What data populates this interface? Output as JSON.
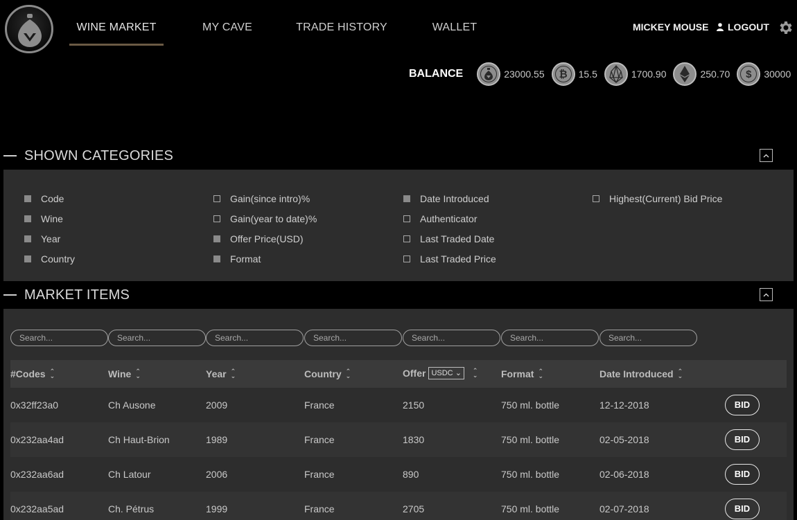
{
  "nav": {
    "items": [
      {
        "label": "WINE MARKET",
        "active": true
      },
      {
        "label": "MY CAVE",
        "active": false
      },
      {
        "label": "TRADE HISTORY",
        "active": false
      },
      {
        "label": "WALLET",
        "active": false
      }
    ]
  },
  "user": {
    "name": "MICKEY MOUSE",
    "logout_label": "LOGOUT"
  },
  "balance": {
    "label": "BALANCE",
    "coins": [
      {
        "icon": "vino-coin-icon",
        "glyph": "",
        "value": "23000.55"
      },
      {
        "icon": "bitcoin-icon",
        "glyph": "₿",
        "value": "15.5"
      },
      {
        "icon": "eos-icon",
        "glyph": "",
        "value": "1700.90"
      },
      {
        "icon": "ethereum-icon",
        "glyph": "",
        "value": "250.70"
      },
      {
        "icon": "dollar-icon",
        "glyph": "$",
        "value": "30000"
      }
    ]
  },
  "categories": {
    "title": "SHOWN CATEGORIES",
    "columns": [
      [
        {
          "label": "Code",
          "checked": true
        },
        {
          "label": "Wine",
          "checked": true
        },
        {
          "label": "Year",
          "checked": true
        },
        {
          "label": "Country",
          "checked": true
        }
      ],
      [
        {
          "label": "Gain(since intro)%",
          "checked": false
        },
        {
          "label": "Gain(year to date)%",
          "checked": false
        },
        {
          "label": "Offer Price(USD)",
          "checked": true
        },
        {
          "label": "Format",
          "checked": true
        }
      ],
      [
        {
          "label": "Date Introduced",
          "checked": true
        },
        {
          "label": "Authenticator",
          "checked": false
        },
        {
          "label": "Last Traded Date",
          "checked": false
        },
        {
          "label": "Last Traded Price",
          "checked": false
        }
      ],
      [
        {
          "label": "Highest(Current) Bid Price",
          "checked": false
        }
      ]
    ]
  },
  "market": {
    "title": "MARKET ITEMS",
    "search_placeholder": "Search...",
    "headers": [
      "#Codes",
      "Wine",
      "Year",
      "Country",
      "Offer",
      "Format",
      "Date Introduced"
    ],
    "currency_select": "USDC",
    "bid_label": "BID",
    "rows": [
      [
        "0x32ff23a0",
        "Ch Ausone",
        "2009",
        "France",
        "2150",
        "750 ml. bottle",
        "12-12-2018"
      ],
      [
        "0x232aa4ad",
        "Ch Haut-Brion",
        "1989",
        "France",
        "1830",
        "750 ml. bottle",
        "02-05-2018"
      ],
      [
        "0x232aa6ad",
        "Ch Latour",
        "2006",
        "France",
        "890",
        "750 ml. bottle",
        "02-06-2018"
      ],
      [
        "0x232aa5ad",
        "Ch. Pétrus",
        "1999",
        "France",
        "2705",
        "750 ml. bottle",
        "02-07-2018"
      ]
    ]
  }
}
